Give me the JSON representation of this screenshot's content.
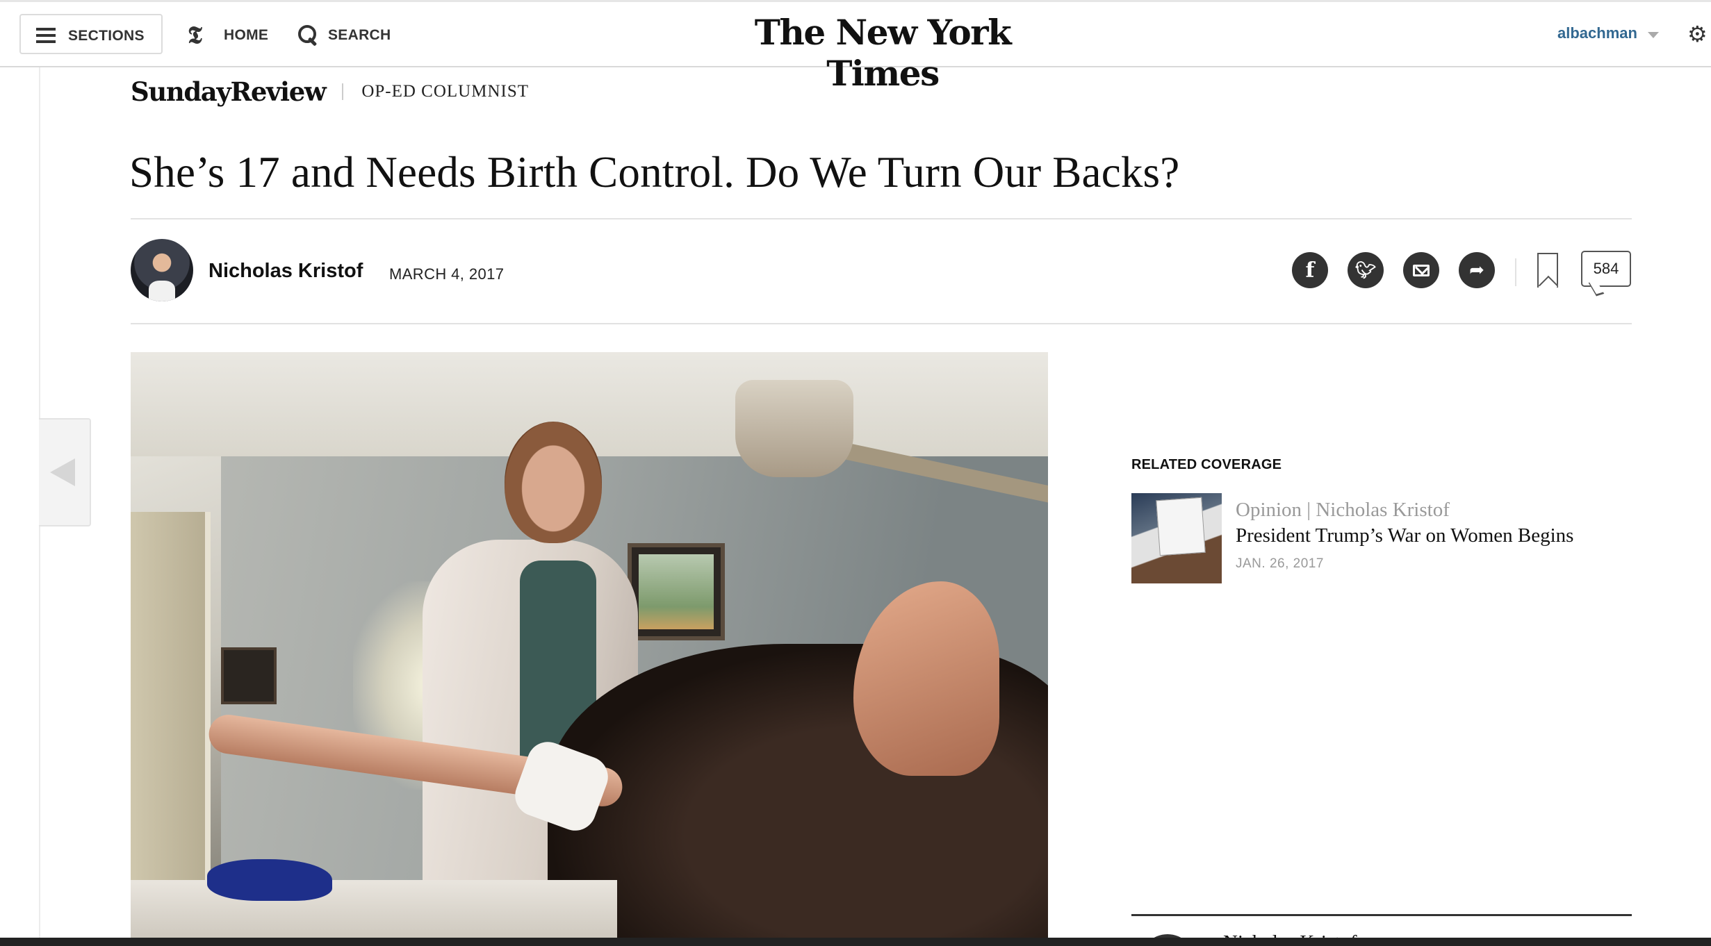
{
  "topbar": {
    "sections_label": "SECTIONS",
    "home_label": "HOME",
    "search_label": "SEARCH",
    "masthead": "The New York Times",
    "username": "albachman",
    "icons": {
      "menu": "hamburger-icon",
      "home": "nyt-t-logo-icon",
      "search": "search-icon",
      "account_caret": "chevron-down-icon",
      "settings": "gear-icon"
    }
  },
  "kicker": {
    "section": "SundayReview",
    "column": "OP-ED COLUMNIST"
  },
  "article": {
    "headline": "She’s 17 and Needs Birth Control. Do We Turn Our Backs?",
    "author": "Nicholas Kristof",
    "date": "MARCH 4, 2017",
    "comment_count": "584"
  },
  "share": {
    "icons": [
      "facebook-icon",
      "twitter-icon",
      "email-icon",
      "share-icon",
      "bookmark-icon",
      "comments-icon"
    ]
  },
  "related": {
    "heading": "RELATED COVERAGE",
    "items": [
      {
        "kicker": "Opinion | Nicholas Kristof",
        "title": "President Trump’s War on Women Begins",
        "date": "JAN. 26, 2017"
      }
    ],
    "next_partial": "Nicholas Kristof"
  },
  "colors": {
    "username": "#326891",
    "icon_fill": "#333333",
    "muted": "#999999"
  }
}
